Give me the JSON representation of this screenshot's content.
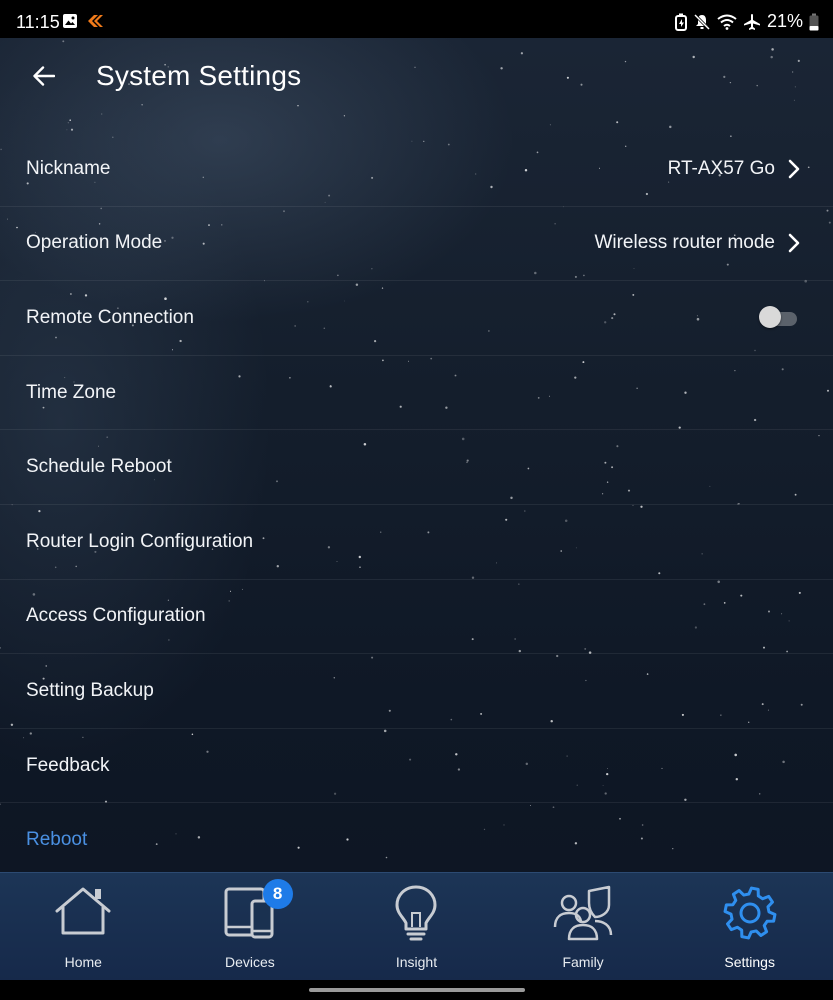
{
  "status_bar": {
    "time": "11:15",
    "battery": "21%",
    "left_icons": [
      "gallery-icon",
      "app-notification-icon"
    ],
    "right_icons": [
      "battery-saver-icon",
      "mute-icon",
      "wifi-icon",
      "airplane-icon",
      "battery-icon"
    ]
  },
  "header": {
    "title": "System Settings",
    "back_icon": "arrow-left-icon"
  },
  "settings": {
    "items": [
      {
        "label": "Nickname",
        "value": "RT-AX57 Go",
        "control": "chevron"
      },
      {
        "label": "Operation Mode",
        "value": "Wireless router mode",
        "control": "chevron"
      },
      {
        "label": "Remote Connection",
        "control": "toggle",
        "enabled": false
      },
      {
        "label": "Time Zone"
      },
      {
        "label": "Schedule Reboot"
      },
      {
        "label": "Router Login Configuration"
      },
      {
        "label": "Access Configuration"
      },
      {
        "label": "Setting Backup"
      },
      {
        "label": "Feedback"
      },
      {
        "label": "Reboot",
        "color": "#4a90e2"
      }
    ]
  },
  "bottom_nav": {
    "items": [
      {
        "label": "Home",
        "icon": "home-icon",
        "active": false
      },
      {
        "label": "Devices",
        "icon": "devices-icon",
        "badge": "8",
        "active": false
      },
      {
        "label": "Insight",
        "icon": "lightbulb-icon",
        "active": false
      },
      {
        "label": "Family",
        "icon": "family-icon",
        "active": false
      },
      {
        "label": "Settings",
        "icon": "gear-icon",
        "active": true
      }
    ],
    "active_color": "#2f8fef",
    "inactive_color": "#c8ccd2"
  }
}
